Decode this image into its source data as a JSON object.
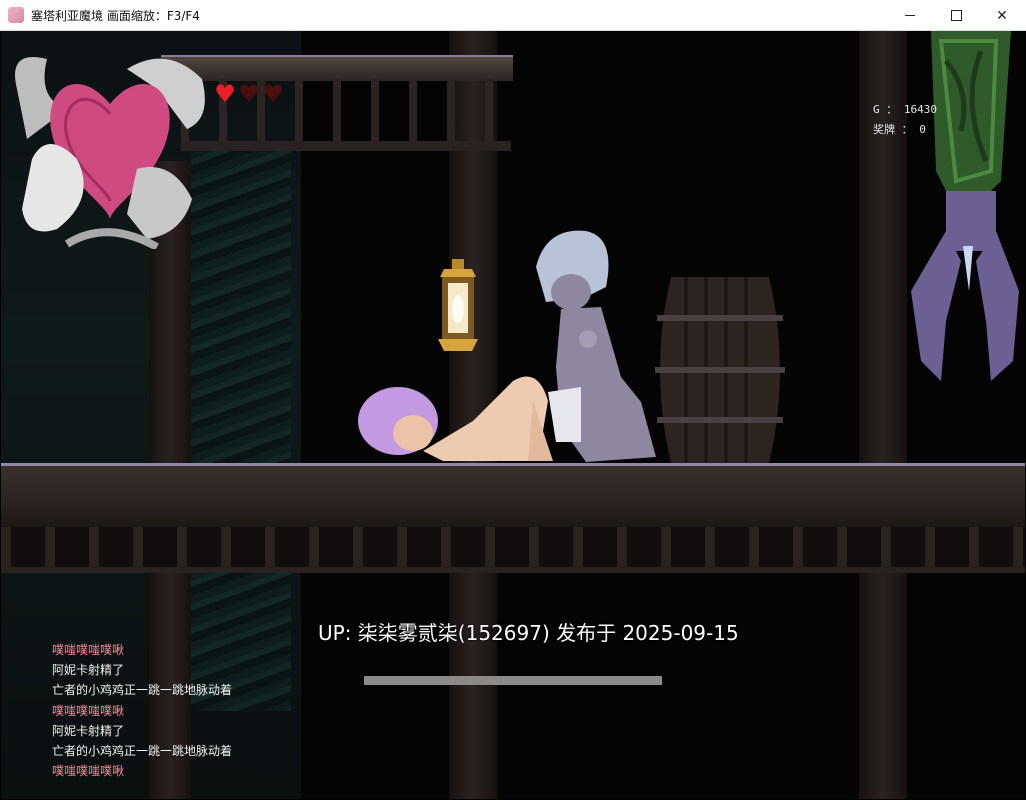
{
  "window": {
    "title": "塞塔利亚魔境  画面缩放：F3/F4",
    "minimize_glyph": "—",
    "maximize_glyph": "☐",
    "close_glyph": "✕"
  },
  "hud": {
    "hearts": [
      {
        "state": "full",
        "glyph": "♥"
      },
      {
        "state": "empty",
        "glyph": "♥"
      },
      {
        "state": "empty",
        "glyph": "♥"
      }
    ],
    "gold_text": "G ： 16430",
    "medals_text": "奖牌 ： 0",
    "heart_full_color": "#e8202a",
    "heart_empty_color": "#4a0e10"
  },
  "upload": {
    "text": "UP: 柒柒雾贰柒(152697) 发布于 2025-09-15",
    "progress": 1.0
  },
  "messages": [
    {
      "text": "噗嗤噗嗤噗啾",
      "color": "pink"
    },
    {
      "text": "阿妮卡射精了",
      "color": "white"
    },
    {
      "text": "亡者的小鸡鸡正一跳一跳地脉动着",
      "color": "white"
    },
    {
      "text": "噗嗤噗嗤噗啾",
      "color": "pink"
    },
    {
      "text": "阿妮卡射精了",
      "color": "white"
    },
    {
      "text": "亡者的小鸡鸡正一跳一跳地脉动着",
      "color": "white"
    },
    {
      "text": "噗嗤噗嗤噗啾",
      "color": "pink"
    }
  ],
  "colors": {
    "message_pink": "#f08a95",
    "message_white": "#f2f2f2",
    "floor_edge": "#8e87a8",
    "wood_dark": "#2b2320"
  }
}
